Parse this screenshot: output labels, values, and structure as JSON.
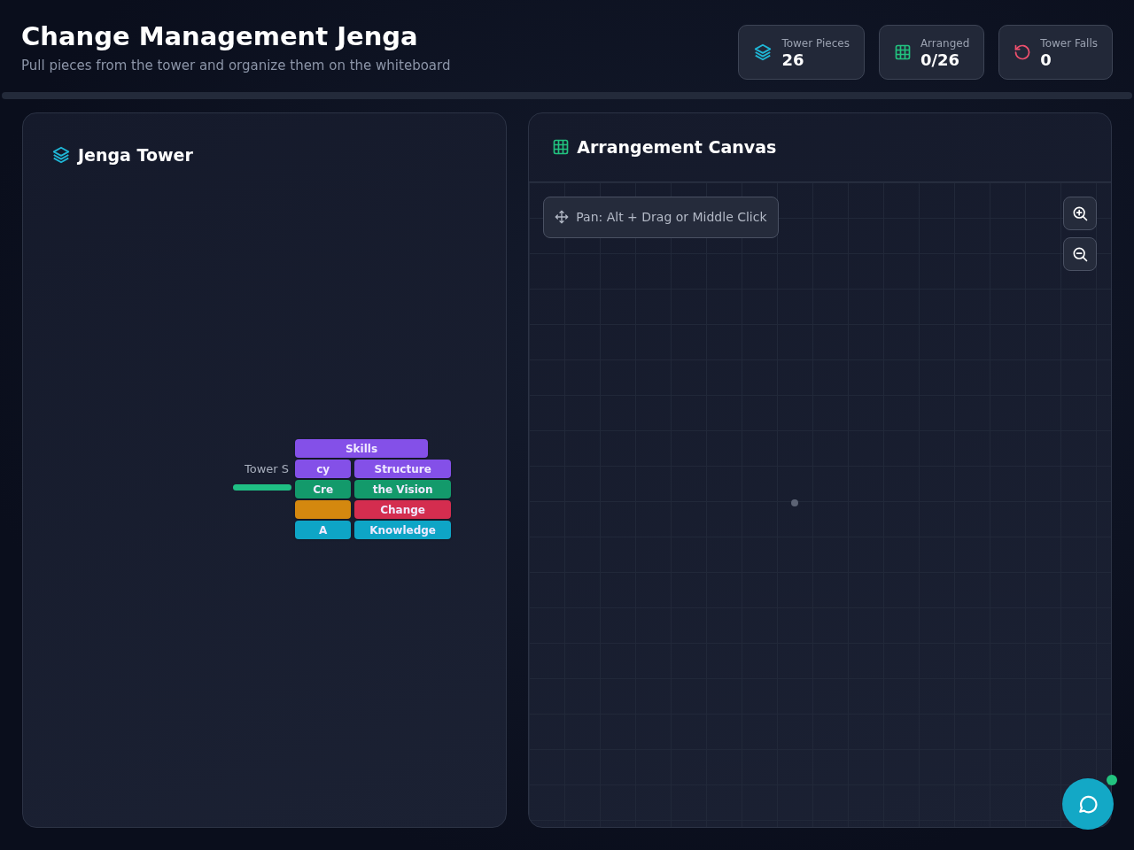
{
  "header": {
    "title": "Change Management Jenga",
    "subtitle": "Pull pieces from the tower and organize them on the whiteboard"
  },
  "stats": [
    {
      "kind": "pieces",
      "label": "Tower Pieces",
      "value": "26"
    },
    {
      "kind": "arranged",
      "label": "Arranged",
      "value": "0/26"
    },
    {
      "kind": "falls",
      "label": "Tower Falls",
      "value": "0"
    }
  ],
  "tower_panel": {
    "title": "Jenga Tower",
    "stability_label": "Tower S",
    "stability": {
      "level": 1
    },
    "blocks": [
      {
        "text": "Skills",
        "color": "#8450e8"
      },
      {
        "text": "cy",
        "color": "#8450e8"
      },
      {
        "text": "Structure",
        "color": "#8450e8"
      },
      {
        "text": "Cre",
        "color": "#139a6b"
      },
      {
        "text": "the Vision",
        "color": "#139a6b"
      },
      {
        "color": "#d4880f"
      },
      {
        "text": "Change",
        "color": "#d42d4f"
      },
      {
        "text": "A",
        "color": "#0ea5c6"
      },
      {
        "text": "Knowledge",
        "color": "#0ea5c6"
      }
    ]
  },
  "canvas_panel": {
    "title": "Arrangement Canvas",
    "hint": "Pan: Alt + Drag or Middle Click"
  },
  "chat": {
    "online": true
  }
}
